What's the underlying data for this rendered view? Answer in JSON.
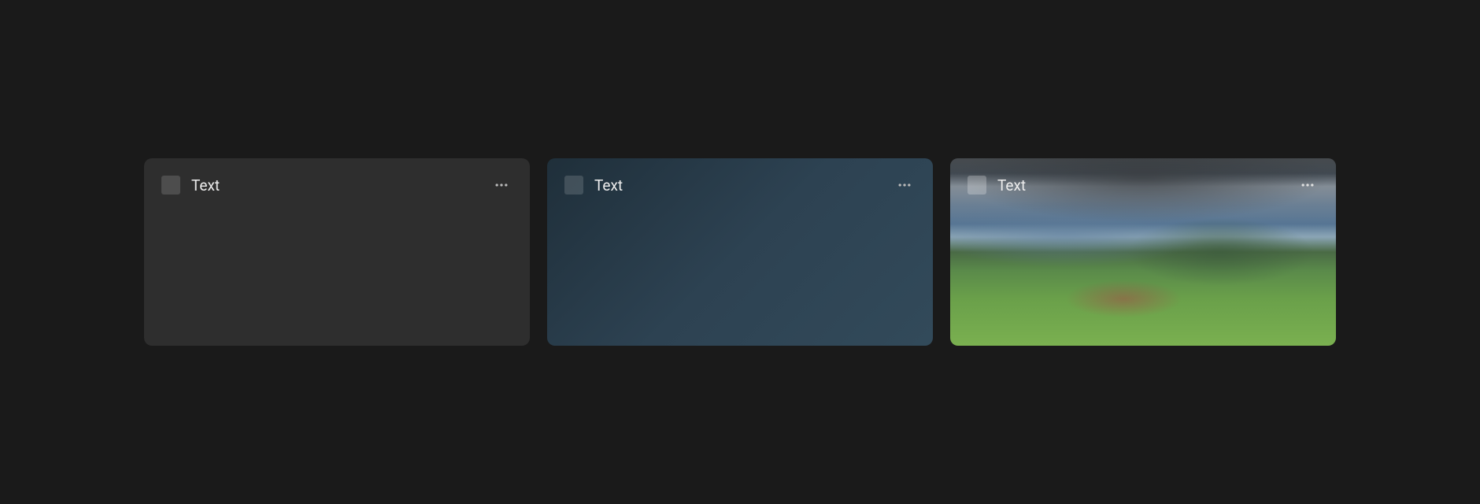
{
  "cards": [
    {
      "title": "Text",
      "variant": "dark"
    },
    {
      "title": "Text",
      "variant": "navy"
    },
    {
      "title": "Text",
      "variant": "image"
    }
  ]
}
